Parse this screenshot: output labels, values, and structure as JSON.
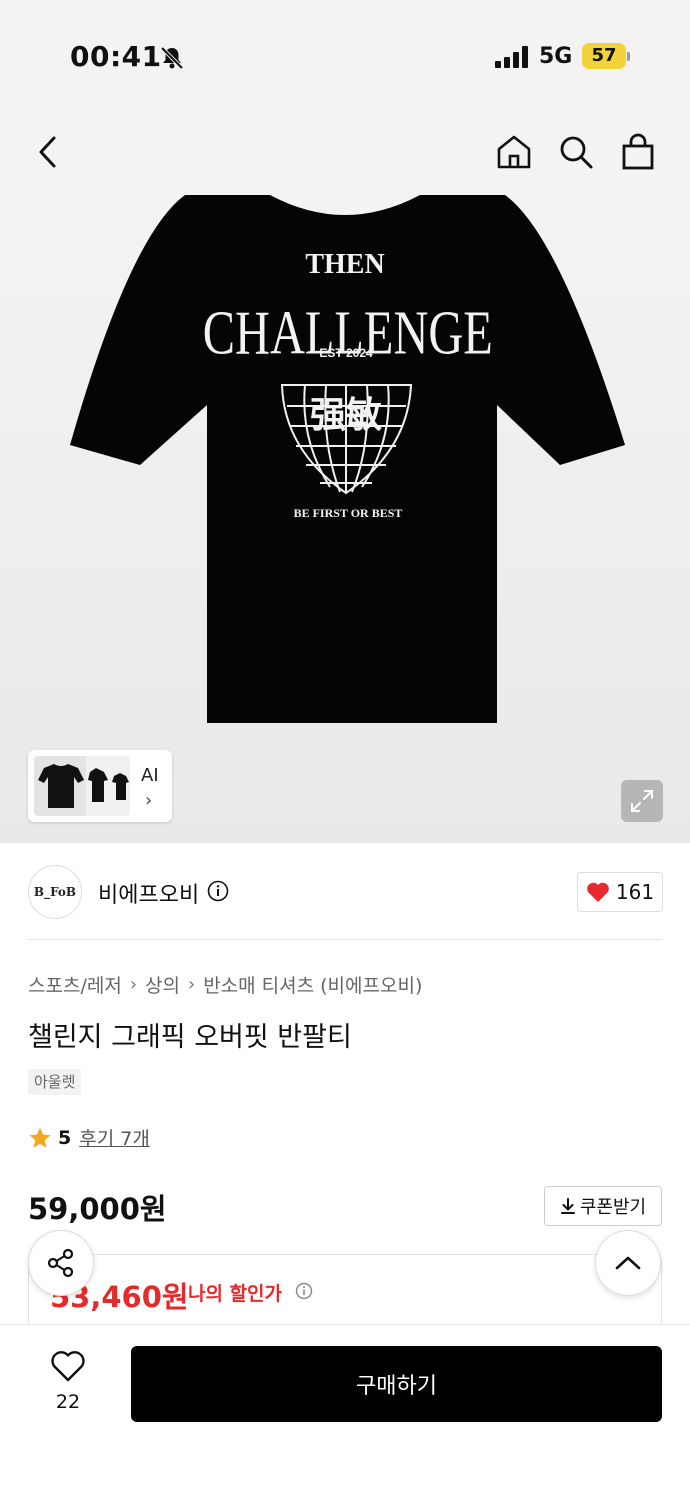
{
  "status_bar": {
    "time": "00:41",
    "network": "5G",
    "battery": "57"
  },
  "nav": {
    "back_icon": "chevron-left-icon",
    "home_icon": "home-icon",
    "search_icon": "search-icon",
    "bag_icon": "shopping-bag-icon"
  },
  "hero": {
    "print_text": {
      "line1": "THEN",
      "line2": "CHALLENGE",
      "est": "EST 2024",
      "hanja": "强敏",
      "slogan": "BE FIRST OR BEST"
    },
    "thumb_label": "AI"
  },
  "brand": {
    "logo_text": "B_FoB",
    "name": "비에프오비",
    "like_count": "161"
  },
  "product": {
    "breadcrumb": [
      "스포츠/레저",
      "상의",
      "반소매 티셔츠 (비에프오비)"
    ],
    "title": "챌린지 그래픽 오버핏 반팔티",
    "tag": "아울렛",
    "rating": "5",
    "review_link": "후기 7개",
    "price": "59,000원",
    "coupon_label": "쿠폰받기",
    "discount_price": "53,460원",
    "discount_label": "나의 할인가"
  },
  "bottom": {
    "wish_count": "22",
    "buy_label": "구매하기"
  },
  "colors": {
    "accent_red": "#e42b2b",
    "heart_red": "#e8292f",
    "star": "#f5a623",
    "battery": "#f2d43a"
  }
}
